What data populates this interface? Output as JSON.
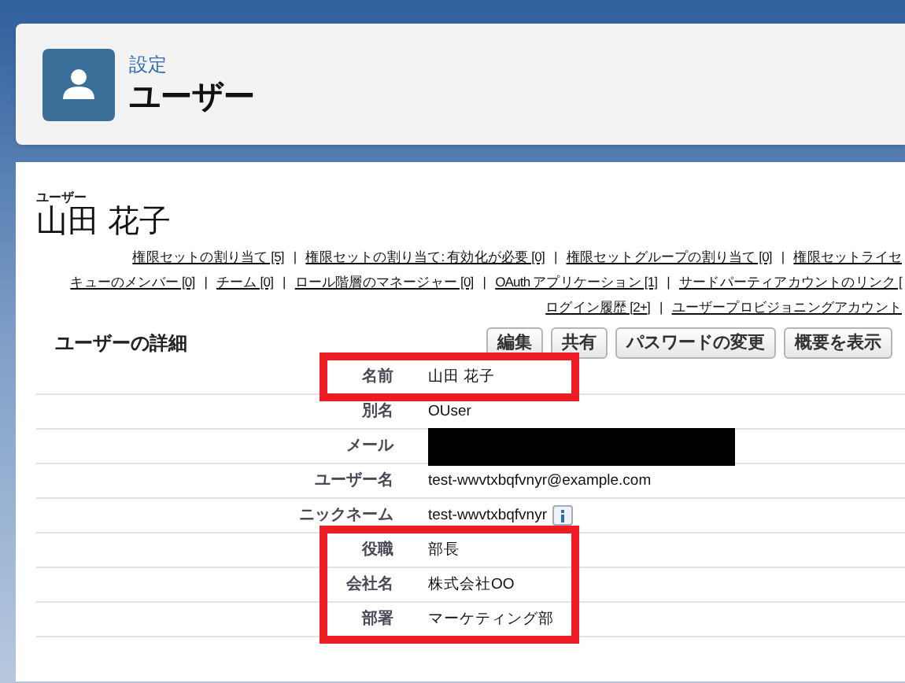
{
  "header": {
    "breadcrumb": "設定",
    "title": "ユーザー"
  },
  "user": {
    "label": "ユーザー",
    "name": "山田 花子"
  },
  "link_rows": [
    [
      {
        "kind": "link",
        "text": "権限セットの割り当て [5]"
      },
      {
        "kind": "separator",
        "text": "|"
      },
      {
        "kind": "link",
        "text": "権限セットの割り当て: 有効化が必要 [0]"
      },
      {
        "kind": "separator",
        "text": "|"
      },
      {
        "kind": "link",
        "text": "権限セットグループの割り当て [0]"
      },
      {
        "kind": "separator",
        "text": "|"
      },
      {
        "kind": "link",
        "text": "権限セットライセ"
      }
    ],
    [
      {
        "kind": "link",
        "text": "キューのメンバー [0]"
      },
      {
        "kind": "separator",
        "text": "|"
      },
      {
        "kind": "link",
        "text": "チーム [0]"
      },
      {
        "kind": "separator",
        "text": "|"
      },
      {
        "kind": "link",
        "text": "ロール階層のマネージャー [0]"
      },
      {
        "kind": "separator",
        "text": "|"
      },
      {
        "kind": "link",
        "text": "OAuth アプリケーション [1]"
      },
      {
        "kind": "separator",
        "text": "|"
      },
      {
        "kind": "link",
        "text": "サードパーティアカウントのリンク ["
      }
    ],
    [
      {
        "kind": "link",
        "text": "ログイン履歴 [2+]"
      },
      {
        "kind": "separator",
        "text": "|"
      },
      {
        "kind": "link",
        "text": "ユーザープロビジョニングアカウント"
      }
    ]
  ],
  "detail": {
    "title": "ユーザーの詳細",
    "buttons": [
      "編集",
      "共有",
      "パスワードの変更",
      "概要を表示"
    ],
    "sections": [
      {
        "highlighted": true,
        "rows": [
          {
            "label": "名前",
            "value": "山田 花子",
            "redacted": false,
            "info": false
          }
        ]
      },
      {
        "highlighted": false,
        "rows": [
          {
            "label": "別名",
            "value": "OUser",
            "redacted": false,
            "info": false
          },
          {
            "label": "メール",
            "redacted": true,
            "info": false
          },
          {
            "label": "ユーザー名",
            "value": "test-wwvtxbqfvnyr@example.com",
            "redacted": false,
            "info": false
          },
          {
            "label": "ニックネーム",
            "value": "test-wwvtxbqfvnyr",
            "redacted": false,
            "info": true
          }
        ]
      },
      {
        "highlighted": true,
        "rows": [
          {
            "label": "役職",
            "value": "部長",
            "redacted": false,
            "info": false
          },
          {
            "label": "会社名",
            "value": "株式会社OO",
            "redacted": false,
            "info": false
          },
          {
            "label": "部署",
            "value": "マーケティング部",
            "redacted": false,
            "info": false
          }
        ]
      }
    ]
  }
}
